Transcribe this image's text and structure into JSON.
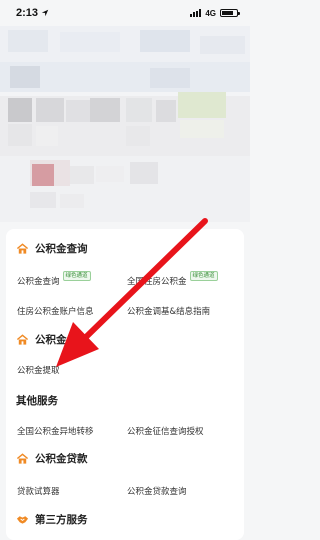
{
  "status_bar": {
    "time": "2:13",
    "network": "4G"
  },
  "sections": {
    "query": {
      "title": "公积金查询",
      "items": [
        {
          "label": "公积金查询",
          "tag": "绿色通道"
        },
        {
          "label": "全国住房公积金",
          "tag": "绿色通道"
        },
        {
          "label": "住房公积金账户信息"
        },
        {
          "label": "公积金调基&结息指南"
        }
      ]
    },
    "withdraw": {
      "title": "公积金",
      "items": [
        {
          "label": "公积金提取"
        }
      ]
    },
    "other": {
      "title": "其他服务",
      "items": [
        {
          "label": "全国公积金异地转移"
        },
        {
          "label": "公积金征信查询授权"
        }
      ]
    },
    "loan": {
      "title": "公积金贷款",
      "items": [
        {
          "label": "贷款试算器"
        },
        {
          "label": "公积金贷款查询"
        }
      ]
    },
    "third": {
      "title": "第三方服务"
    }
  },
  "colors": {
    "accent_orange": "#f08a24",
    "arrow_red": "#e8141b",
    "tag_green": "#3a8f3a"
  }
}
